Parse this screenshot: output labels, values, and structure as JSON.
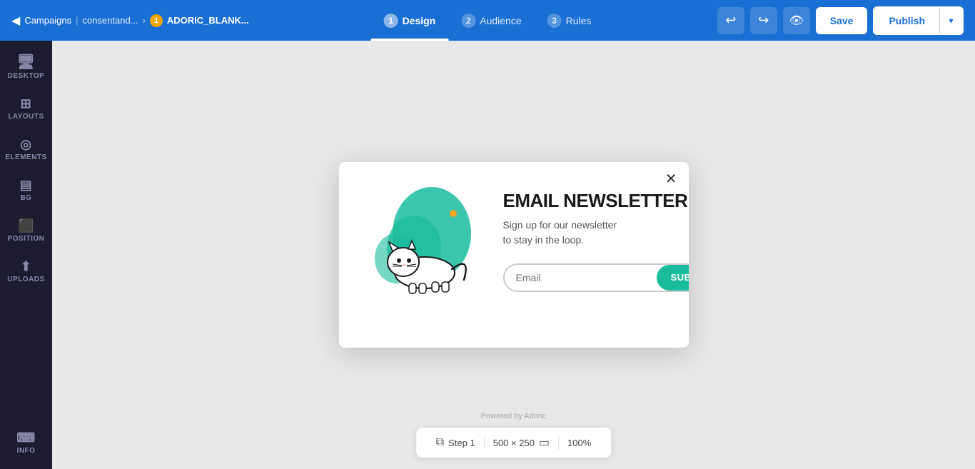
{
  "topnav": {
    "back_icon": "◀",
    "campaigns_label": "Campaigns",
    "sep1": "|",
    "domain": "consentand...",
    "arrow": "›",
    "badge_color": "#f0a500",
    "badge_num": "1",
    "campaign_name": "ADORIC_BLANK...",
    "steps": [
      {
        "num": "1",
        "label": "Design",
        "active": true
      },
      {
        "num": "2",
        "label": "Audience",
        "active": false
      },
      {
        "num": "3",
        "label": "Rules",
        "active": false
      }
    ],
    "undo_icon": "↩",
    "redo_icon": "↪",
    "preview_icon": "👁",
    "save_label": "Save",
    "publish_label": "Publish",
    "dropdown_icon": "▾"
  },
  "sidebar": {
    "items": [
      {
        "id": "desktop",
        "icon": "🖥",
        "label": "DESKTOP"
      },
      {
        "id": "layouts",
        "icon": "⊞",
        "label": "LAYOUTS"
      },
      {
        "id": "elements",
        "icon": "◎",
        "label": "ELEMENTS"
      },
      {
        "id": "bg",
        "icon": "▤",
        "label": "BG"
      },
      {
        "id": "position",
        "icon": "⬛",
        "label": "POSITION"
      },
      {
        "id": "uploads",
        "icon": "⬆",
        "label": "UPLOADS"
      },
      {
        "id": "info",
        "icon": "⌨",
        "label": "INFO"
      }
    ]
  },
  "popup": {
    "close_icon": "✕",
    "title": "EMAIL NEWSLETTER",
    "subtitle": "Sign up for our newsletter\nto stay in the loop.",
    "email_placeholder": "Email",
    "subscribe_label": "SUBSCRIBE",
    "powered_by": "Powered by Adoric"
  },
  "bottom_bar": {
    "step_icon": "⧉",
    "step_label": "Step 1",
    "dimensions": "500 × 250",
    "screen_icon": "▭",
    "zoom": "100%"
  }
}
